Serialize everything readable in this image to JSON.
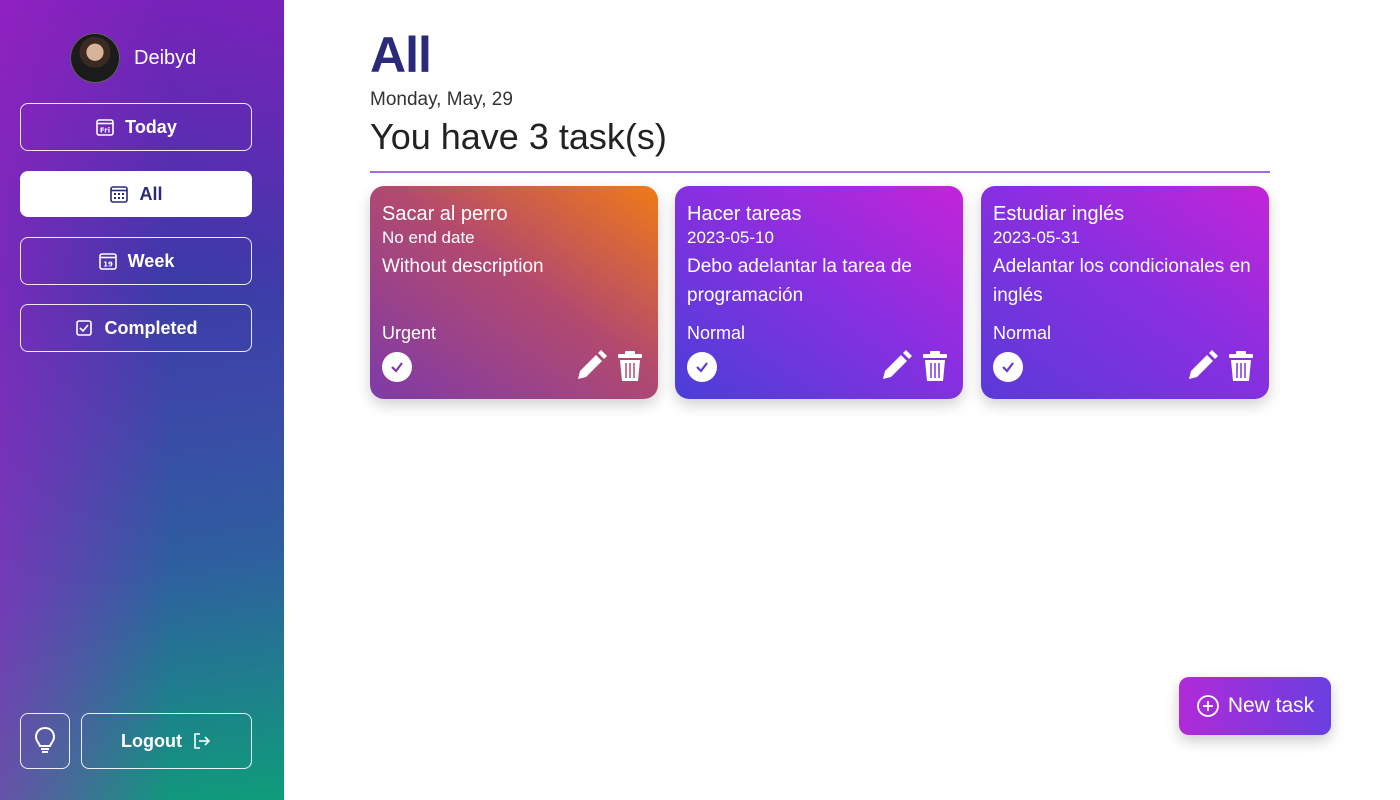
{
  "user": {
    "name": "Deibyd"
  },
  "sidebar": {
    "nav": [
      {
        "label": "Today",
        "icon": "calendar-fri-icon",
        "active": false
      },
      {
        "label": "All",
        "icon": "calendar-grid-icon",
        "active": true
      },
      {
        "label": "Week",
        "icon": "calendar-19-icon",
        "active": false
      },
      {
        "label": "Completed",
        "icon": "checkbox-icon",
        "active": false
      }
    ],
    "today_icon_text": "Fri",
    "week_icon_text": "19",
    "logout_label": "Logout"
  },
  "header": {
    "title": "All",
    "date": "Monday, May, 29",
    "count_text": "You have 3 task(s)"
  },
  "tasks": [
    {
      "title": "Sacar al perro",
      "date": "No end date",
      "description": "Without description",
      "priority": "Urgent"
    },
    {
      "title": "Hacer tareas",
      "date": "2023-05-10",
      "description": "Debo adelantar la tarea de programación",
      "priority": "Normal"
    },
    {
      "title": "Estudiar inglés",
      "date": "2023-05-31",
      "description": "Adelantar los condicionales en inglés",
      "priority": "Normal"
    }
  ],
  "new_task_label": "New task",
  "colors": {
    "accent": "#2b2a7a",
    "divider": "#a66be0"
  }
}
